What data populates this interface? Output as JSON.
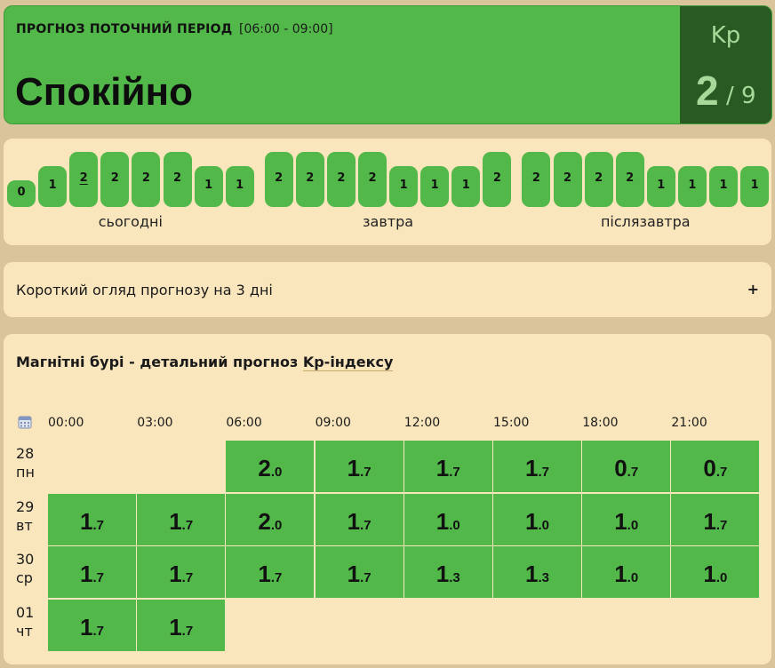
{
  "current": {
    "title": "ПРОГНОЗ ПОТОЧНИЙ ПЕРІОД",
    "range": "[06:00 - 09:00]",
    "status": "Спокійно",
    "kp_label": "Kp",
    "kp_value": "2",
    "kp_max": "/ 9",
    "status_color": "#52b84a"
  },
  "bars": {
    "days": [
      "сьогодні",
      "завтра",
      "післязавтра"
    ],
    "values": [
      [
        0,
        1,
        2,
        2,
        2,
        2,
        1,
        1
      ],
      [
        2,
        2,
        2,
        2,
        1,
        1,
        1,
        2
      ],
      [
        2,
        2,
        2,
        2,
        1,
        1,
        1,
        1
      ]
    ],
    "current_index": [
      0,
      2
    ]
  },
  "summary": {
    "text": "Короткий огляд прогнозу на 3 дні",
    "expand_label": "+"
  },
  "detail": {
    "title_prefix": "Магнітні бурі - детальний прогноз ",
    "title_link": "Kp-індексу",
    "times": [
      "00:00",
      "03:00",
      "06:00",
      "09:00",
      "12:00",
      "15:00",
      "18:00",
      "21:00"
    ],
    "rows": [
      {
        "date": "28",
        "weekday": "пн",
        "cells": [
          null,
          null,
          "2.0",
          "1.7",
          "1.7",
          "1.7",
          "0.7",
          "0.7"
        ]
      },
      {
        "date": "29",
        "weekday": "вт",
        "cells": [
          "1.7",
          "1.7",
          "2.0",
          "1.7",
          "1.0",
          "1.0",
          "1.0",
          "1.7"
        ]
      },
      {
        "date": "30",
        "weekday": "ср",
        "cells": [
          "1.7",
          "1.7",
          "1.7",
          "1.7",
          "1.3",
          "1.3",
          "1.0",
          "1.0"
        ]
      },
      {
        "date": "01",
        "weekday": "чт",
        "cells": [
          "1.7",
          "1.7",
          null,
          null,
          null,
          null,
          null,
          null
        ]
      }
    ],
    "icon": "calendar-icon"
  }
}
